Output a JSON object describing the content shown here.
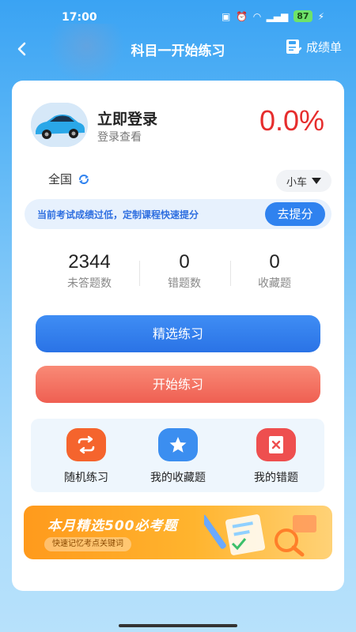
{
  "status_bar": {
    "time": "17:00",
    "battery": "87"
  },
  "nav": {
    "title": "科目一开始练习",
    "scorecard_label": "成绩单"
  },
  "profile": {
    "login_title": "立即登录",
    "login_subtitle": "登录查看",
    "pass_rate": "0.0%"
  },
  "filters": {
    "region": "全国",
    "vehicle": "小车"
  },
  "notice": {
    "text": "当前考试成绩过低，定制课程快速提分",
    "button": "去提分"
  },
  "stats": [
    {
      "value": "2344",
      "label": "未答题数"
    },
    {
      "value": "0",
      "label": "错题数"
    },
    {
      "value": "0",
      "label": "收藏题"
    }
  ],
  "buttons": {
    "selected_practice": "精选练习",
    "start_practice": "开始练习"
  },
  "quick_actions": [
    {
      "label": "随机练习",
      "icon": "shuffle-icon",
      "color": "#f5642d"
    },
    {
      "label": "我的收藏题",
      "icon": "star-icon",
      "color": "#3b8ef0"
    },
    {
      "label": "我的错题",
      "icon": "wrong-book-icon",
      "color": "#ee4f4f"
    }
  ],
  "banner": {
    "title": "本月精选500必考题",
    "subtitle": "快速记忆考点关键词"
  },
  "colors": {
    "accent": "#2f82ef",
    "danger": "#e62d2d",
    "start_button": "#ef5f52"
  }
}
